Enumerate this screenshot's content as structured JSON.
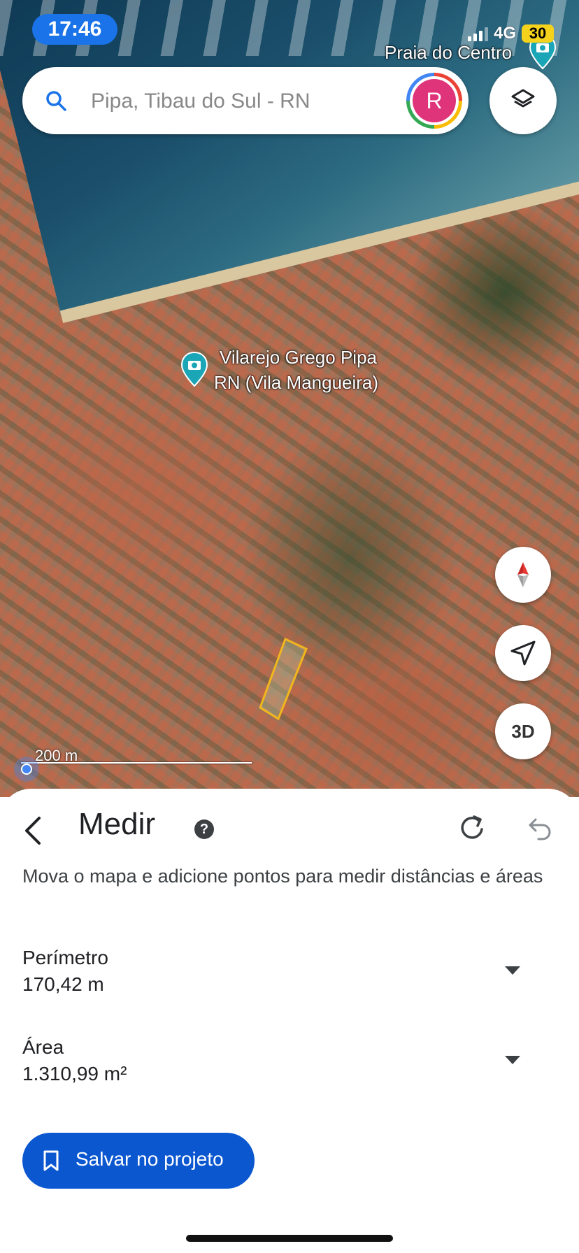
{
  "status_bar": {
    "time": "17:46",
    "network": "4G",
    "battery": "30"
  },
  "search": {
    "placeholder": "Pipa, Tibau do Sul - RN",
    "avatar_initial": "R"
  },
  "map": {
    "labels": {
      "poi_1": "Praia do Centro",
      "poi_2_line1": "Vilarejo Grego Pipa",
      "poi_2_line2": "RN (Vila Mangueira)"
    },
    "scale": "200 m",
    "button_3d": "3D",
    "measure_outline_color": "#f2b61d"
  },
  "sheet": {
    "title": "Medir",
    "help": "?",
    "instructions": "Mova o mapa e adicione pontos para medir distâncias e áreas",
    "perimeter": {
      "label": "Perímetro",
      "value": "170,42 m"
    },
    "area": {
      "label": "Área",
      "value": "1.310,99 m²"
    },
    "save_button": "Salvar no projeto"
  },
  "colors": {
    "accent": "#0b57d0",
    "time_pill": "#1a73e8",
    "avatar": "#e0347a",
    "poi_pin": "#1aa6b7"
  }
}
